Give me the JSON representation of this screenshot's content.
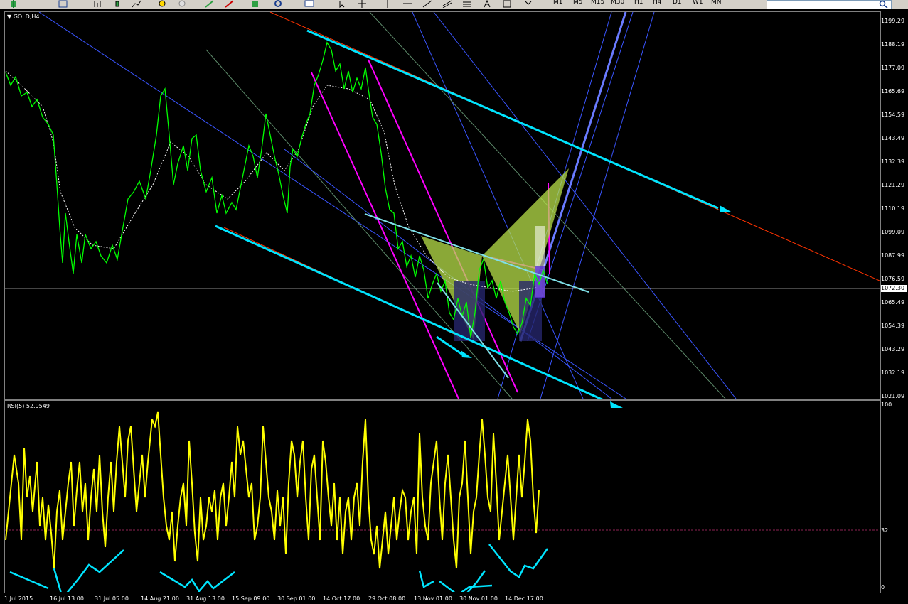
{
  "toolbar": {
    "timeframes": [
      "M1",
      "M5",
      "M15",
      "M30",
      "H1",
      "H4",
      "D1",
      "W1",
      "MN"
    ],
    "search_placeholder": ""
  },
  "chart": {
    "title": "GOLD,H4",
    "current_price": "1072.30",
    "price_labels": [
      "1199.29",
      "1188.19",
      "1177.09",
      "1165.69",
      "1154.59",
      "1143.49",
      "1132.39",
      "1121.29",
      "1110.19",
      "1099.09",
      "1087.99",
      "1076.59",
      "1065.49",
      "1054.39",
      "1043.29",
      "1032.19",
      "1021.09"
    ],
    "time_labels": [
      "1 Jul 2015",
      "16 Jul 13:00",
      "31 Jul 05:00",
      "14 Aug 21:00",
      "31 Aug 13:00",
      "15 Sep 09:00",
      "30 Sep 01:00",
      "14 Oct 17:00",
      "29 Oct 08:00",
      "13 Nov 01:00",
      "30 Nov 01:00",
      "14 Dec 17:00"
    ],
    "colors": {
      "price": "#00ff00",
      "ma": "#ffffff",
      "channel": "#00e5ff",
      "magenta": "#ff00ff",
      "pattern": "#b8e04a",
      "grid_line": "#ff3300",
      "blue_line": "#3a55ff"
    }
  },
  "rsi": {
    "title": "RSI(5) 52.9549",
    "levels": [
      "100",
      "32",
      "0"
    ],
    "colors": {
      "line": "#ffff00",
      "level": "#8b2252",
      "arrows": "#00e5ff"
    }
  },
  "chart_data": {
    "type": "line",
    "title": "GOLD,H4",
    "xlabel": "",
    "ylabel": "",
    "ylim": [
      1021.09,
      1199.29
    ],
    "x": [
      "1 Jul 2015",
      "16 Jul 13:00",
      "31 Jul 05:00",
      "14 Aug 21:00",
      "31 Aug 13:00",
      "15 Sep 09:00",
      "30 Sep 01:00",
      "14 Oct 17:00",
      "29 Oct 08:00",
      "13 Nov 01:00",
      "30 Nov 01:00",
      "14 Dec 17:00"
    ],
    "series": [
      {
        "values": [
          1169,
          1101,
          1093,
          1117,
          1110,
          1110,
          1130,
          1177,
          1155,
          1075,
          1060,
          1070
        ]
      }
    ]
  }
}
